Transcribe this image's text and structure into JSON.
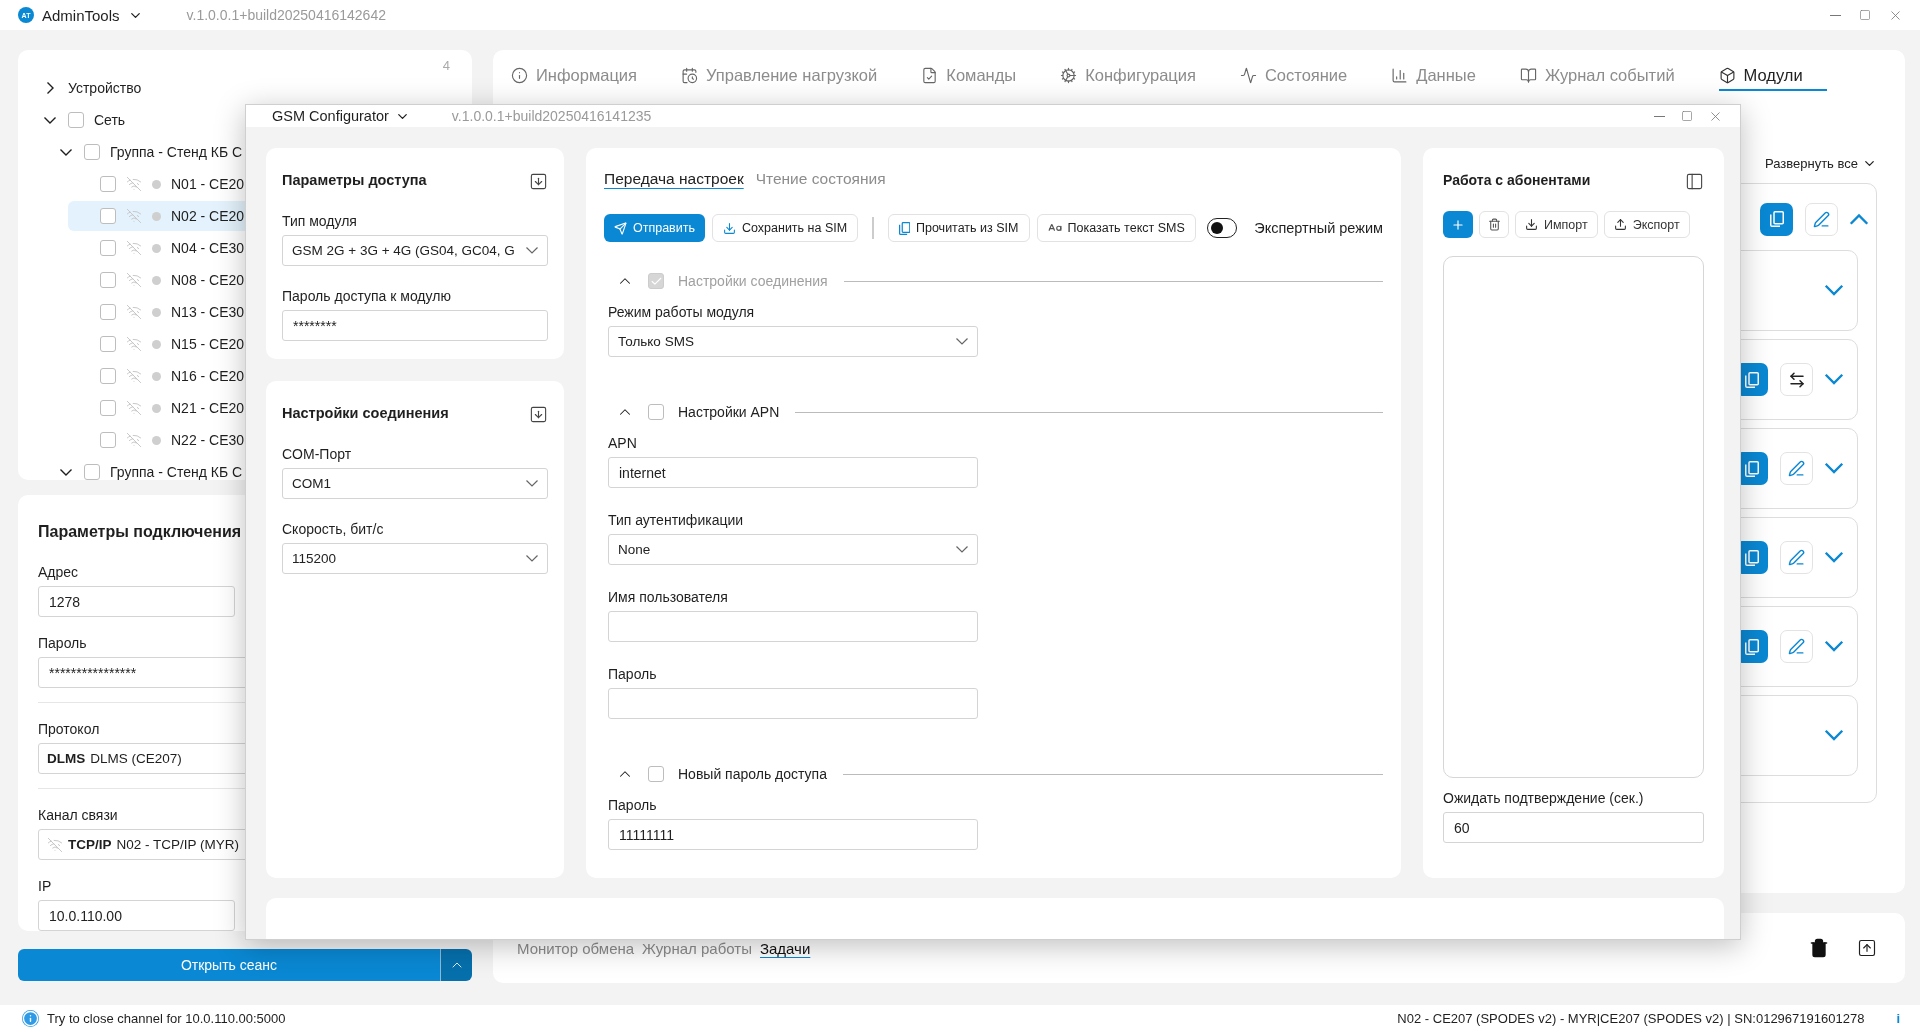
{
  "app": {
    "logo": "AT",
    "title": "AdminTools",
    "version": "v.1.0.0.1+build20250416142642"
  },
  "tree": {
    "count": "4",
    "items": [
      {
        "kind": "category",
        "label": "Устройство",
        "expanded": false
      },
      {
        "kind": "group",
        "label": "Сеть",
        "expanded": true,
        "checked": false,
        "children": [
          {
            "kind": "group",
            "label": "Группа - Стенд КБ С",
            "expanded": true,
            "checked": false,
            "children": [
              {
                "kind": "device",
                "label": "N01 - CE20",
                "checked": false,
                "selected": false
              },
              {
                "kind": "device",
                "label": "N02 - CE20",
                "checked": false,
                "selected": true
              },
              {
                "kind": "device",
                "label": "N04 - CE30",
                "checked": false,
                "selected": false
              },
              {
                "kind": "device",
                "label": "N08 - CE20",
                "checked": false,
                "selected": false
              },
              {
                "kind": "device",
                "label": "N13 - CE30",
                "checked": false,
                "selected": false
              },
              {
                "kind": "device",
                "label": "N15 - CE20",
                "checked": false,
                "selected": false
              },
              {
                "kind": "device",
                "label": "N16 - CE20",
                "checked": false,
                "selected": false
              },
              {
                "kind": "device",
                "label": "N21 - CE20",
                "checked": false,
                "selected": false
              },
              {
                "kind": "device",
                "label": "N22 - CE30",
                "checked": false,
                "selected": false
              }
            ]
          },
          {
            "kind": "group",
            "label": "Группа - Стенд КБ С",
            "expanded": true,
            "checked": false
          }
        ]
      }
    ]
  },
  "connection": {
    "title": "Параметры подключения",
    "fields": [
      {
        "kind": "short",
        "label": "Адрес",
        "value": "1278"
      },
      {
        "kind": "wide",
        "label": "Пароль",
        "value": "****************"
      },
      {
        "kind": "tag",
        "label": "Протокол",
        "tag": "DLMS",
        "value": "DLMS (CE207)"
      },
      {
        "kind": "channel",
        "label": "Канал связи",
        "tag": "TCP/IP",
        "value": "N02 - TCP/IP (MYR)"
      },
      {
        "kind": "short",
        "label": "IP",
        "value": "10.0.110.00"
      }
    ]
  },
  "session_button": {
    "label": "Открыть сеанс"
  },
  "tabs": [
    {
      "kind": "info",
      "label": "Информация",
      "selected": false
    },
    {
      "kind": "load",
      "label": "Управление нагрузкой",
      "selected": false
    },
    {
      "kind": "commands",
      "label": "Команды",
      "selected": false
    },
    {
      "kind": "config",
      "label": "Конфигурация",
      "selected": false
    },
    {
      "kind": "state",
      "label": "Состояние",
      "selected": false
    },
    {
      "kind": "data",
      "label": "Данные",
      "selected": false
    },
    {
      "kind": "events",
      "label": "Журнал событий",
      "selected": false
    },
    {
      "kind": "modules",
      "label": "Модули",
      "selected": true
    }
  ],
  "expand_all": "Развернуть все",
  "modules": {
    "expanded": true,
    "rows": [
      {
        "actions": [
          {
            "kind": "expand"
          }
        ],
        "expanded": false
      },
      {
        "actions": [
          {
            "kind": "copy"
          },
          {
            "kind": "swap"
          },
          {
            "kind": "expand"
          }
        ],
        "expanded": false
      },
      {
        "actions": [
          {
            "kind": "copy"
          },
          {
            "kind": "edit"
          },
          {
            "kind": "expand"
          }
        ],
        "expanded": false
      },
      {
        "actions": [
          {
            "kind": "copy"
          },
          {
            "kind": "edit"
          },
          {
            "kind": "expand"
          }
        ],
        "expanded": false
      },
      {
        "actions": [
          {
            "kind": "copy"
          },
          {
            "kind": "edit"
          },
          {
            "kind": "expand"
          }
        ],
        "expanded": false
      },
      {
        "actions": [
          {
            "kind": "expand"
          }
        ],
        "expanded": false
      }
    ]
  },
  "bottom_tabs": [
    {
      "label": "Монитор обмена",
      "selected": false
    },
    {
      "label": "Журнал работы",
      "selected": false
    },
    {
      "label": "Задачи",
      "selected": true
    }
  ],
  "status": {
    "message": "Try to close channel for 10.0.110.00:5000",
    "device": "N02 - CE207 (SPODES v2) - MYR|CE207 (SPODES v2) | SN:012967191601278",
    "info": "i"
  },
  "dialog": {
    "title": "GSM Configurator",
    "version": "v.1.0.0.1+build20250416141235",
    "cards": [
      {
        "title": "Параметры доступа",
        "fields": [
          {
            "kind": "select",
            "label": "Тип модуля",
            "value": "GSM 2G + 3G + 4G (GS04, GC04, G"
          },
          {
            "kind": "text",
            "label": "Пароль доступа к модулю",
            "value": "********"
          }
        ]
      },
      {
        "title": "Настройки соединения",
        "fields": [
          {
            "kind": "select",
            "label": "COM-Порт",
            "value": "COM1"
          },
          {
            "kind": "select",
            "label": "Скорость, бит/с",
            "value": "115200"
          }
        ]
      }
    ],
    "tabs": [
      {
        "label": "Передача настроек",
        "selected": true
      },
      {
        "label": "Чтение состояния",
        "selected": false
      }
    ],
    "toolbar": [
      {
        "kind": "send",
        "label": "Отправить"
      },
      {
        "kind": "save",
        "label": "Сохранить на SIM"
      },
      {
        "kind": "divider"
      },
      {
        "kind": "read",
        "label": "Прочитать из SIM"
      },
      {
        "kind": "sms",
        "label": "Показать текст SMS"
      }
    ],
    "expert": {
      "label": "Экспертный режим",
      "on": false
    },
    "sections": [
      {
        "title": "Настройки соединения",
        "expanded": true,
        "checked": true,
        "disabled": true,
        "fields": [
          {
            "kind": "select",
            "label": "Режим работы модуля",
            "value": "Только SMS"
          }
        ]
      },
      {
        "title": "Настройки APN",
        "expanded": true,
        "checked": false,
        "disabled": false,
        "fields": [
          {
            "kind": "text",
            "label": "APN",
            "value": "internet"
          },
          {
            "kind": "select",
            "label": "Тип аутентификации",
            "value": "None"
          },
          {
            "kind": "text",
            "label": "Имя пользователя"
          },
          {
            "kind": "text",
            "label": "Пароль"
          }
        ]
      },
      {
        "title": "Новый пароль доступа",
        "expanded": true,
        "checked": false,
        "disabled": false,
        "fields": [
          {
            "kind": "text",
            "label": "Пароль",
            "value": "11111111"
          }
        ]
      }
    ],
    "subscribers": {
      "title": "Работа с абонентами",
      "buttons": [
        {
          "kind": "add"
        },
        {
          "kind": "delete"
        },
        {
          "kind": "import",
          "label": "Импорт"
        },
        {
          "kind": "export",
          "label": "Экспорт"
        }
      ],
      "wait": {
        "label": "Ожидать подтверждение (сек.)",
        "value": "60"
      }
    }
  }
}
